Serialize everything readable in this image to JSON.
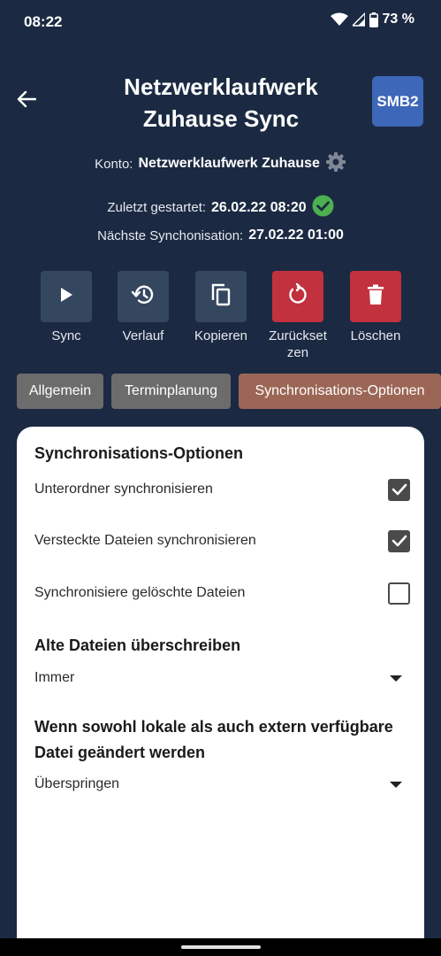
{
  "status_bar": {
    "time": "08:22",
    "battery": "73 %",
    "icons": [
      "wifi-icon",
      "signal-icon",
      "battery-icon"
    ]
  },
  "header": {
    "title": "Netzwerklaufwerk Zuhause Sync",
    "badge": "SMB2",
    "back_icon": "arrow-left-icon"
  },
  "info": {
    "konto_label": "Konto:",
    "konto_value": "Netzwerklaufwerk Zuhause",
    "last_label": "Zuletzt gestartet:",
    "last_value": "26.02.22 08:20",
    "next_label": "Nächste Synchonisation:",
    "next_value": "27.02.22 01:00"
  },
  "actions": [
    {
      "label": "Sync",
      "icon": "play-icon"
    },
    {
      "label": "Verlauf",
      "icon": "history-icon"
    },
    {
      "label": "Kopieren",
      "icon": "copy-icon"
    },
    {
      "label": "Zurücksetzen",
      "icon": "reset-icon"
    },
    {
      "label": "Löschen",
      "icon": "trash-icon"
    }
  ],
  "tabs": [
    {
      "label": "Allgemein",
      "active": false
    },
    {
      "label": "Terminplanung",
      "active": false
    },
    {
      "label": "Synchronisations-Optionen",
      "active": true
    }
  ],
  "card": {
    "section_title": "Synchronisations-Optionen",
    "options": [
      {
        "label": "Unterordner synchronisieren",
        "checked": true
      },
      {
        "label": "Versteckte Dateien synchronisieren",
        "checked": true
      },
      {
        "label": "Synchronisiere gelöschte Dateien",
        "checked": false
      }
    ],
    "overwrite_title": "Alte Dateien überschreiben",
    "overwrite_value": "Immer",
    "conflict_title": "Wenn sowohl lokale als auch extern verfügbare Datei geändert werden",
    "conflict_value": "Überspringen"
  },
  "colors": {
    "background": "#1b2a42",
    "button_dark": "#34475f",
    "button_red": "#c1313e",
    "tab_grey": "#6c6c6c",
    "tab_active": "#9c6656",
    "badge": "#3d67b8",
    "success": "#4caf50"
  }
}
